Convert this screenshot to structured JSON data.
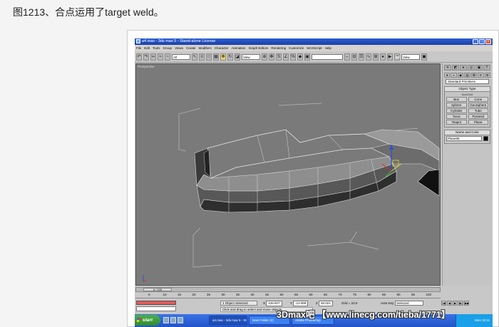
{
  "caption": "图1213、合点运用了target weld。",
  "window": {
    "title": "a4.max - 3ds max 5 - Stand-alone License",
    "buttons": [
      "_",
      "□",
      "×"
    ]
  },
  "menu": [
    "File",
    "Edit",
    "Tools",
    "Group",
    "Views",
    "Create",
    "Modifiers",
    "Character",
    "Animation",
    "Graph Editors",
    "Rendering",
    "Customize",
    "MAXScript",
    "Help"
  ],
  "toolbar": {
    "selection_filter": "All",
    "reference_coord": "View",
    "named_selection": "",
    "right_view": "View"
  },
  "viewport": {
    "label": "Perspective"
  },
  "command_panel": {
    "tabs": [
      "✳",
      "◩",
      "♠",
      "◎",
      "▣",
      "T"
    ],
    "category_icons": [
      "●",
      "◐",
      "◉",
      "▤",
      "❂",
      "≋",
      "⚙"
    ],
    "primitive_type": "Standard Primitives",
    "object_type_title": "Object Type",
    "autogrid_label": "AutoGrid",
    "object_buttons": [
      "Box",
      "Cone",
      "Sphere",
      "GeoSphere",
      "Cylinder",
      "Tube",
      "Torus",
      "Pyramid",
      "Teapot",
      "Plane"
    ],
    "name_color_title": "Name and Color",
    "object_name": "Plane08",
    "object_color": "#000000"
  },
  "timeline": {
    "frame_display": "0 / 100",
    "ticks": [
      "0",
      "10",
      "15",
      "20",
      "25",
      "30",
      "35",
      "40",
      "45",
      "50",
      "55",
      "60",
      "65",
      "70",
      "75",
      "80",
      "85",
      "90",
      "95",
      "100"
    ]
  },
  "status": {
    "selection": "1 Object Selected",
    "prompt": "Click and drag to select and move objects",
    "x_label": "X",
    "x_value": "126.927",
    "y_label": "Y",
    "y_value": "-12.909",
    "z_label": "Z",
    "z_value": "46.021",
    "grid": "Grid = 10.0",
    "auto_key": "Auto Key",
    "set_key_filter": "Selected",
    "playback": [
      "|◀",
      "◀",
      "▶",
      "▶|",
      "▶▶"
    ]
  },
  "taskbar": {
    "start": "start",
    "items": [
      "a4.max - 3ds max 5 - Stan...",
      "New Folder (2)",
      "Adobe Photoshop"
    ],
    "clock": "Mon 10:11"
  },
  "watermark": "3Dmax吧 【www.linecg.com/tieba/1771】"
}
